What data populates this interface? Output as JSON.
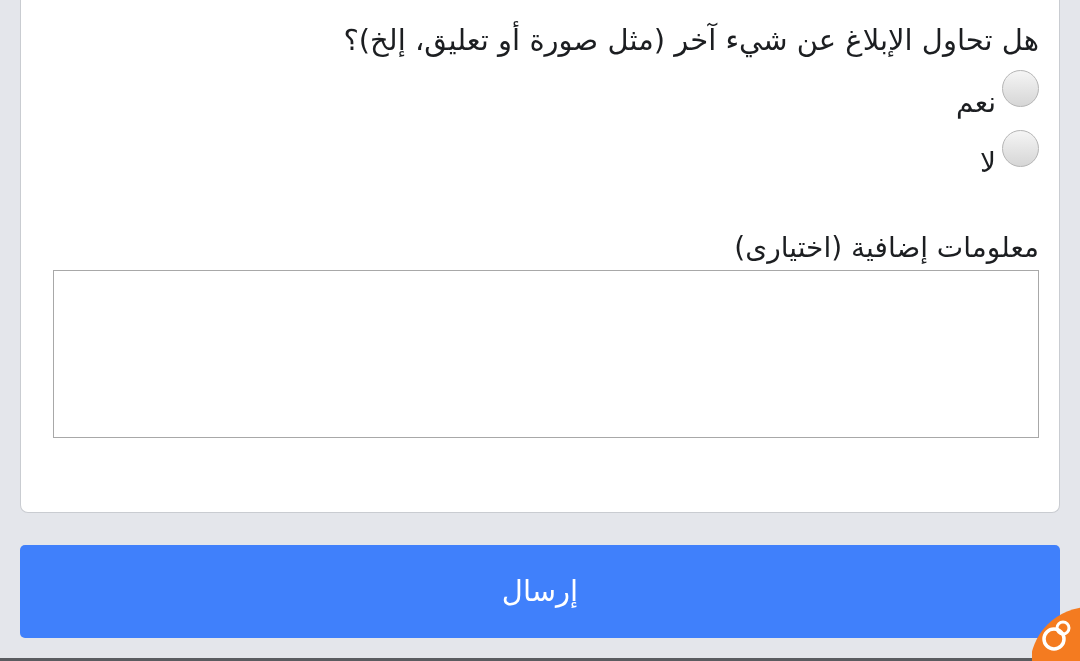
{
  "question": {
    "text": "هل تحاول الإبلاغ عن شيء آخر (مثل صورة أو تعليق، إلخ)؟",
    "options": [
      {
        "label": "نعم",
        "selected": false
      },
      {
        "label": "لا",
        "selected": false
      }
    ]
  },
  "additional_info": {
    "label": "معلومات إضافية (اختيارى)"
  },
  "submit_button": {
    "label": "إرسال"
  }
}
